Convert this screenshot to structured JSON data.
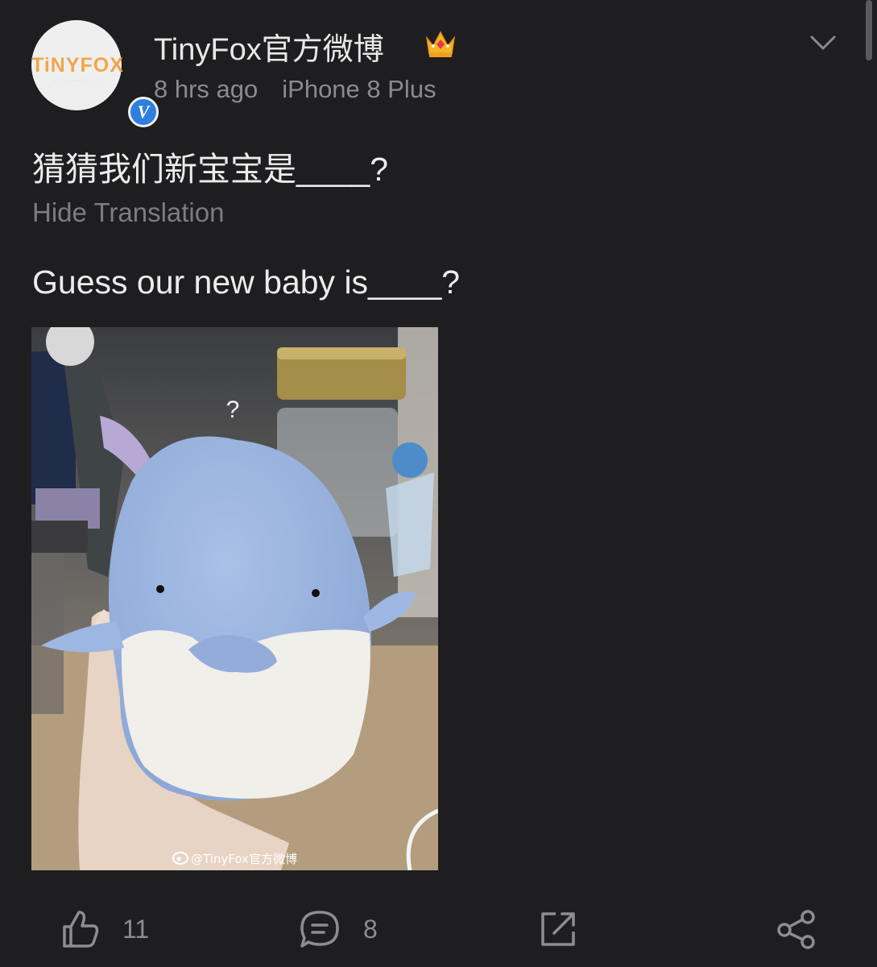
{
  "post": {
    "author": {
      "name": "TinyFox官方微博",
      "avatar_logo_text": "TiNYFOX",
      "verified_mark": "V"
    },
    "time": "8 hrs ago",
    "device": "iPhone 8 Plus",
    "text_original": "猜猜我们新宝宝是____?",
    "hide_translation_label": "Hide Translation",
    "text_translated": "Guess our new baby is____?",
    "image": {
      "watermark": "@TinyFox官方微博",
      "question_mark": "?"
    }
  },
  "actions": {
    "likes": "11",
    "comments": "8"
  },
  "colors": {
    "background": "#1e1e20",
    "verified_badge": "#2f7ee0",
    "secondary_text": "#8b8b8e"
  },
  "icons": [
    "crown-icon",
    "chevron-down-icon",
    "verified-icon",
    "like-icon",
    "comment-icon",
    "repost-icon",
    "share-icon",
    "weibo-icon"
  ]
}
